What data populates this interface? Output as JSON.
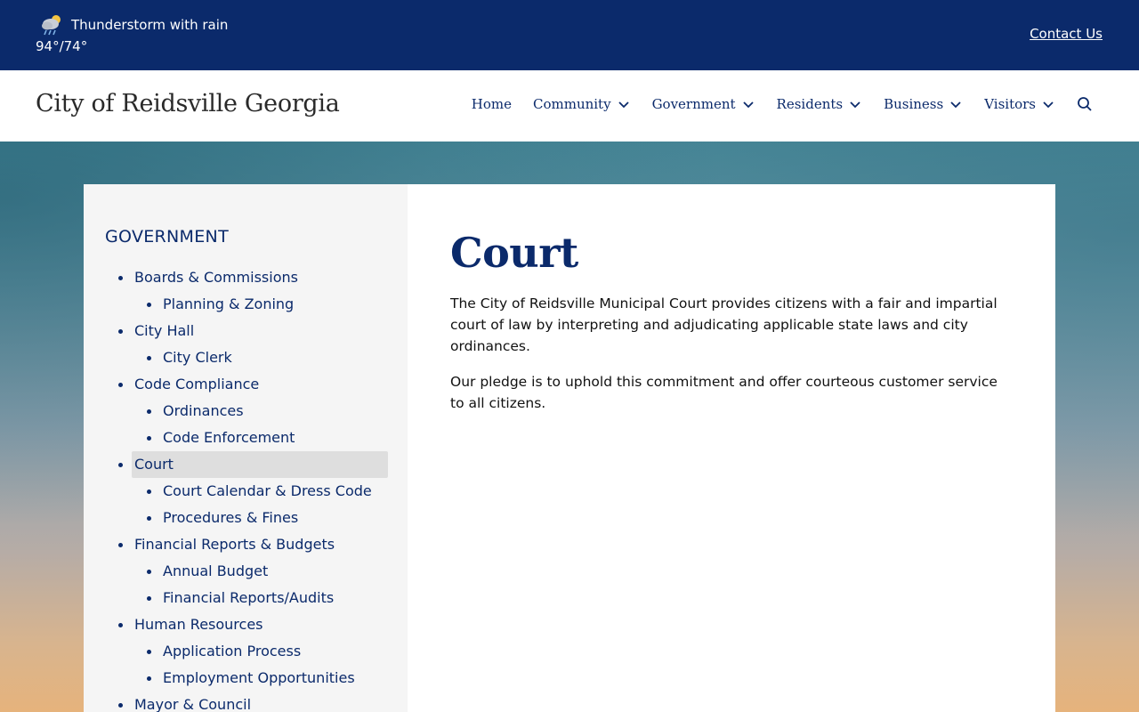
{
  "alert": {
    "weather_condition": "Thunderstorm with rain",
    "weather_temp": "94°/74°",
    "weather_icon": "storm-cloud-icon",
    "contact_label": "Contact Us"
  },
  "header": {
    "site_title": "City of Reidsville Georgia",
    "nav": [
      {
        "label": "Home"
      },
      {
        "label": "Community"
      },
      {
        "label": "Government"
      },
      {
        "label": "Residents"
      },
      {
        "label": "Business"
      },
      {
        "label": "Visitors"
      }
    ]
  },
  "sidebar": {
    "heading": "GOVERNMENT",
    "items": [
      {
        "label": "Boards & Commissions"
      },
      {
        "label": "Planning & Zoning"
      },
      {
        "label": "City Hall"
      },
      {
        "label": "City Clerk"
      },
      {
        "label": "Code Compliance"
      },
      {
        "label": "Ordinances"
      },
      {
        "label": "Code Enforcement"
      },
      {
        "label": "Court"
      },
      {
        "label": "Court Calendar & Dress Code"
      },
      {
        "label": "Procedures & Fines"
      },
      {
        "label": "Financial Reports & Budgets"
      },
      {
        "label": "Annual Budget"
      },
      {
        "label": "Financial Reports/Audits"
      },
      {
        "label": "Human Resources"
      },
      {
        "label": "Application Process"
      },
      {
        "label": "Employment Opportunities"
      },
      {
        "label": "Mayor & Council"
      }
    ]
  },
  "main": {
    "title": "Court",
    "paragraphs": [
      "The City of Reidsville Municipal Court provides citizens with a fair and impartial court of law by interpreting and adjudicating applicable state laws and city ordinances.",
      "Our pledge is to uphold this commitment and offer courteous customer service to all citizens."
    ]
  },
  "colors": {
    "brand_navy": "#0b2a6b",
    "sidebar_bg": "#f5f5f5",
    "active_bg": "#dedede"
  }
}
